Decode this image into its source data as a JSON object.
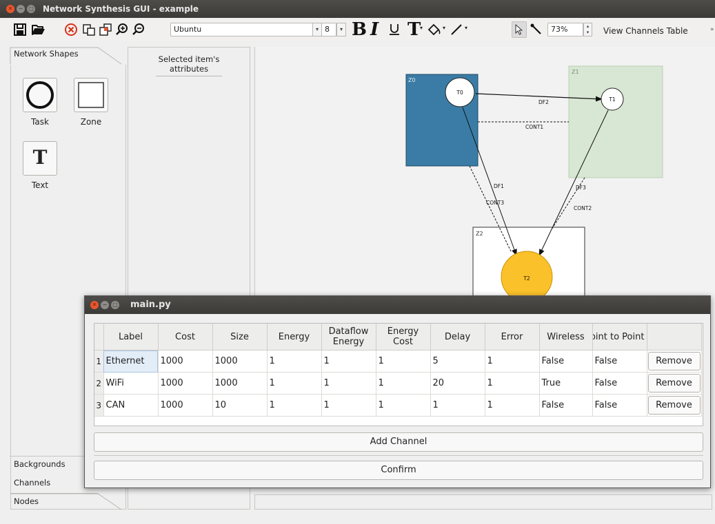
{
  "window": {
    "title": "Network Synthesis GUI - example"
  },
  "toolbar": {
    "font_family": "Ubuntu",
    "font_size": "8",
    "zoom": "73%",
    "view_channels_label": "View Channels Table",
    "icons": [
      "save-icon",
      "open-icon",
      "delete-icon",
      "bring-front-icon",
      "send-back-icon",
      "zoom-in-icon",
      "zoom-out-icon",
      "bold-icon",
      "italic-icon",
      "underline-icon",
      "text-color-icon",
      "fill-color-icon",
      "line-color-icon",
      "pointer-icon",
      "line-tool-icon"
    ]
  },
  "left_panel": {
    "tab_shapes": "Network Shapes",
    "shapes": [
      {
        "label": "Task",
        "icon": "circle-icon"
      },
      {
        "label": "Zone",
        "icon": "square-icon"
      },
      {
        "label": "Text",
        "icon": "text-t-icon",
        "glyph": "T"
      }
    ],
    "tab_backgrounds": "Backgrounds",
    "tab_channels": "Channels",
    "tab_nodes": "Nodes"
  },
  "attributes_panel": {
    "header": "Selected item's attributes"
  },
  "diagram": {
    "zones": [
      {
        "id": "Z0",
        "color": "#3a7ca5"
      },
      {
        "id": "Z1",
        "color": "#d8e7d3"
      },
      {
        "id": "Z2",
        "color": "#ffffff"
      }
    ],
    "tasks": [
      {
        "id": "T0",
        "color": "#ffffff"
      },
      {
        "id": "T1",
        "color": "#ffffff"
      },
      {
        "id": "T2",
        "color": "#fac12a"
      }
    ],
    "edge_labels": {
      "df2": "DF2",
      "cont1": "CONT1",
      "df1": "DF1",
      "cont3": "CONT3",
      "df3": "DF3",
      "cont2": "CONT2"
    }
  },
  "dialog": {
    "title": "main.py",
    "columns": [
      "Label",
      "Cost",
      "Size",
      "Energy",
      "Dataflow Energy",
      "Energy Cost",
      "Delay",
      "Error",
      "Wireless",
      "Point to Point"
    ],
    "rows": [
      {
        "num": "1",
        "cells": [
          "Ethernet",
          "1000",
          "1000",
          "1",
          "1",
          "1",
          "5",
          "1",
          "False",
          "False"
        ]
      },
      {
        "num": "2",
        "cells": [
          "WiFi",
          "1000",
          "1000",
          "1",
          "1",
          "1",
          "20",
          "1",
          "True",
          "False"
        ]
      },
      {
        "num": "3",
        "cells": [
          "CAN",
          "1000",
          "10",
          "1",
          "1",
          "1",
          "1",
          "1",
          "False",
          "False"
        ]
      }
    ],
    "remove_label": "Remove",
    "add_channel_label": "Add Channel",
    "confirm_label": "Confirm"
  }
}
